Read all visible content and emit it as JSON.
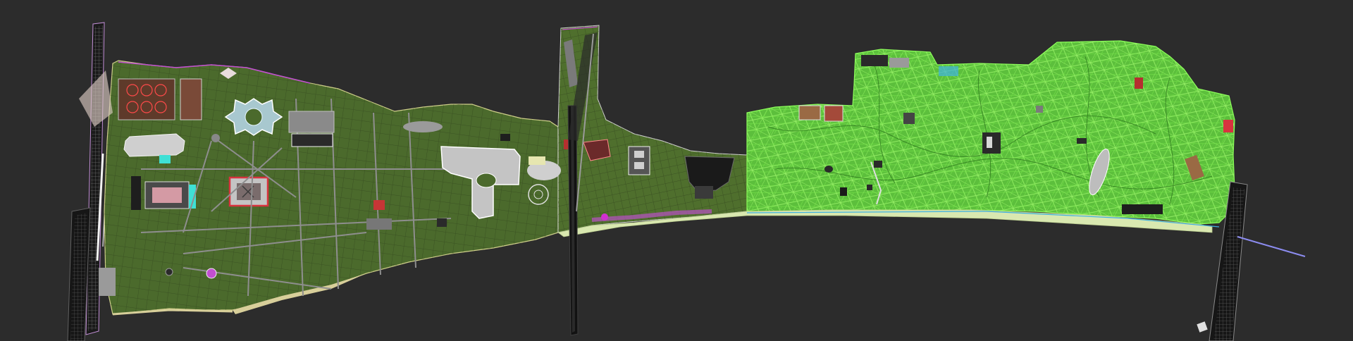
{
  "viewport": {
    "background": "#2c2c2c",
    "tool": "3d-modeling-viewport"
  },
  "colors": {
    "lawn_dark": "#4b6a2c",
    "lawn_mid": "#57782f",
    "forest_green": "#5cbf3c",
    "forest_wire": "#8cff5a",
    "forest_wire_dim": "#3f9a2a",
    "path_gray": "#8e8e8e",
    "building_gray": "#bdbdbd",
    "bridge_black": "#121212",
    "road_dark": "#3a3a3a",
    "sand": "#d8cf9a",
    "magenta_edge": "#c24fd1",
    "river_blue": "#8c8cf0",
    "selection_red": "#d8333f",
    "cyan_marker": "#3fe0d5",
    "white_marker": "#f2f2f2"
  },
  "map": {
    "regions": [
      {
        "name": "formal-garden-west",
        "fill": "lawn_dark"
      },
      {
        "name": "urban-central",
        "fill": "lawn_mid"
      },
      {
        "name": "wooded-park-east",
        "fill": "forest_green"
      }
    ],
    "landmarks": [
      {
        "name": "star-fountain"
      },
      {
        "name": "central-plaza-building"
      },
      {
        "name": "rectangular-monument"
      },
      {
        "name": "oval-basin"
      },
      {
        "name": "pond-east"
      },
      {
        "name": "riverside-promenade"
      },
      {
        "name": "central-bridge"
      },
      {
        "name": "west-pier"
      },
      {
        "name": "east-pier"
      }
    ]
  }
}
